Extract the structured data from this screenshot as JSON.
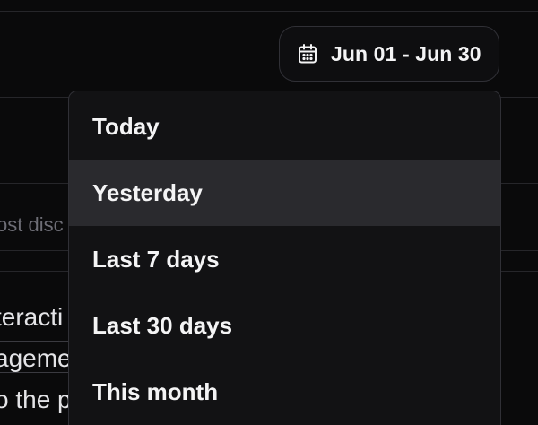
{
  "date_range": {
    "label": "Jun 01 - Jun 30",
    "icon": "calendar-icon"
  },
  "background": {
    "placeholder": "ost disc",
    "lines": [
      "teracti",
      "ageme",
      "o the p"
    ]
  },
  "dropdown": {
    "items": [
      {
        "label": "Today"
      },
      {
        "label": "Yesterday"
      },
      {
        "label": "Last 7 days"
      },
      {
        "label": "Last 30 days"
      },
      {
        "label": "This month"
      }
    ],
    "highlighted_index": 1
  },
  "colors": {
    "background": "#0a0a0b",
    "menu_background": "#121214",
    "highlight": "#2a2a2e",
    "text": "#f4f4f5",
    "border": "#303036"
  }
}
